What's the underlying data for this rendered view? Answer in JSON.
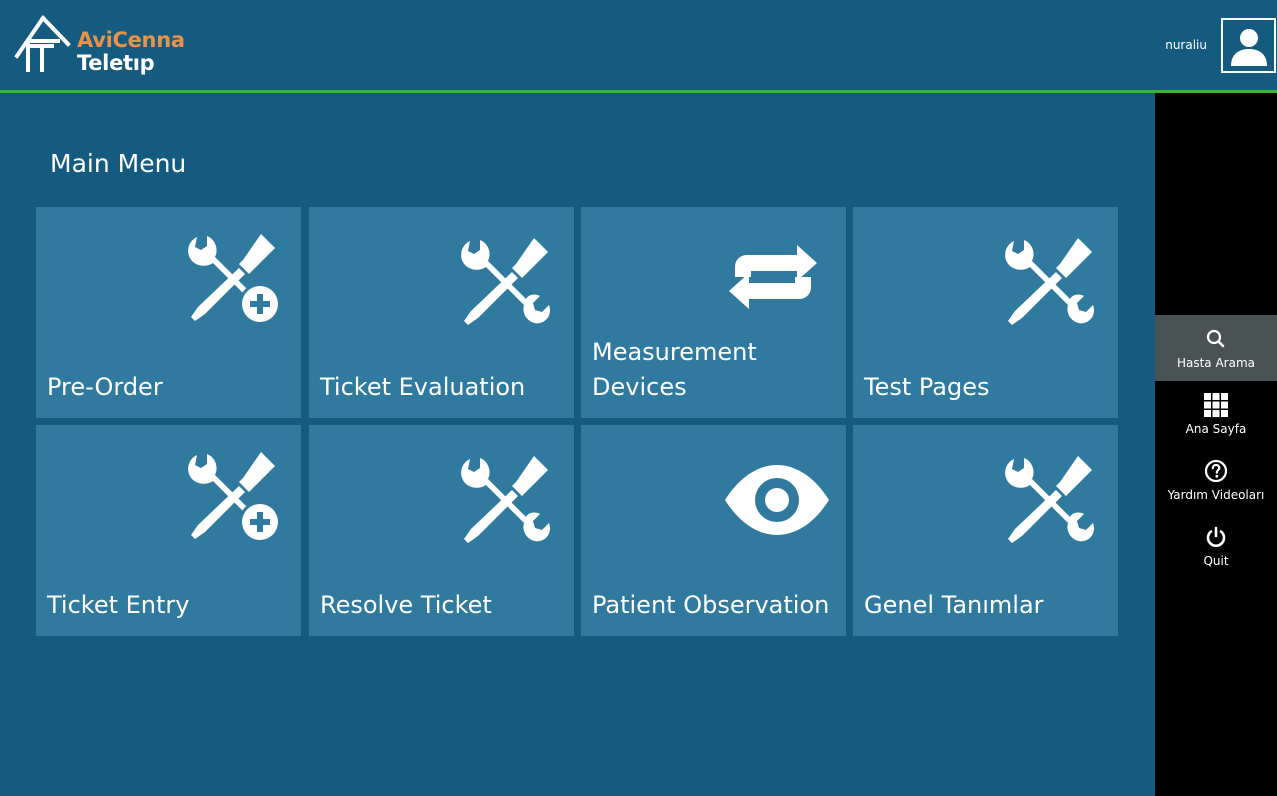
{
  "header": {
    "logo_line1": "AviCenna",
    "logo_line2": "Teletıp",
    "username": "nuraliu"
  },
  "main": {
    "title": "Main Menu",
    "tiles": [
      {
        "label": "Pre-Order",
        "icon": "tools-plus-icon"
      },
      {
        "label": "Ticket Evaluation",
        "icon": "tools-icon"
      },
      {
        "label": "Measurement Devices",
        "icon": "sync-arrows-icon"
      },
      {
        "label": "Test Pages",
        "icon": "tools-icon"
      },
      {
        "label": "Ticket Entry",
        "icon": "tools-plus-icon"
      },
      {
        "label": "Resolve Ticket",
        "icon": "tools-icon"
      },
      {
        "label": "Patient Observation",
        "icon": "eye-icon"
      },
      {
        "label": "Genel Tanımlar",
        "icon": "tools-icon"
      }
    ]
  },
  "sidebar": {
    "items": [
      {
        "label": "Hasta Arama",
        "icon": "search-icon",
        "active": true
      },
      {
        "label": "Ana Sayfa",
        "icon": "grid-icon",
        "active": false
      },
      {
        "label": "Yardım Videoları",
        "icon": "help-icon",
        "active": false
      },
      {
        "label": "Quit",
        "icon": "power-icon",
        "active": false
      }
    ]
  },
  "colors": {
    "background": "#155b80",
    "tile": "#2f7a9e",
    "accent_green": "#3cb04a",
    "logo_orange": "#e8924a",
    "sidebar": "#000000",
    "sidebar_active": "#4a5354"
  }
}
